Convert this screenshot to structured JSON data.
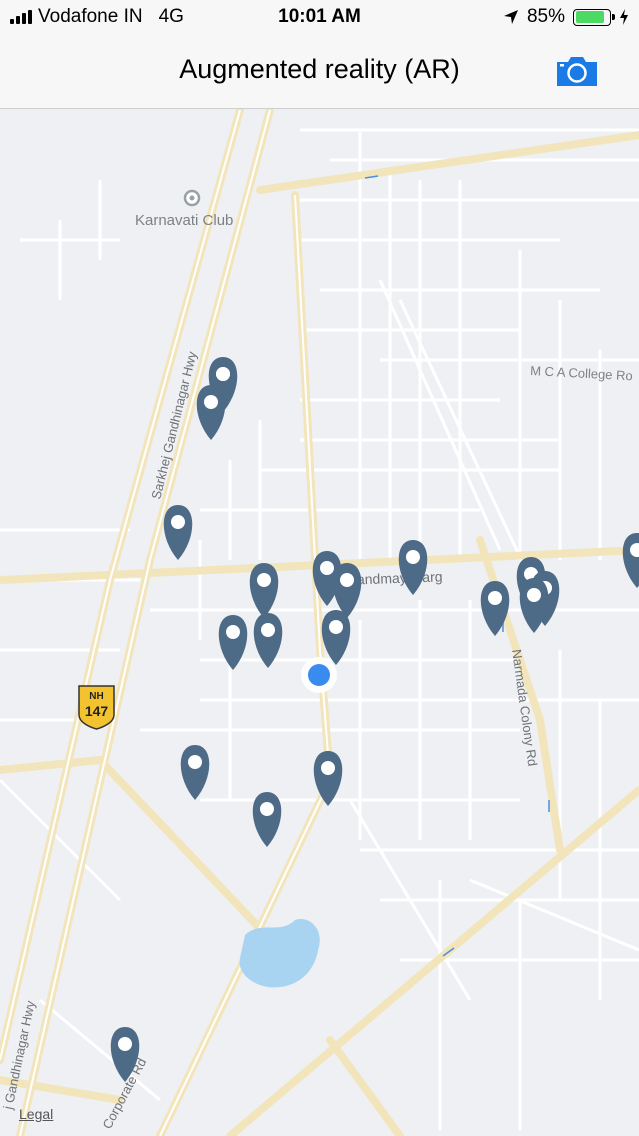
{
  "status_bar": {
    "carrier": "Vodafone IN",
    "network": "4G",
    "time": "10:01 AM",
    "battery_percent": "85%",
    "battery_level": 0.85
  },
  "nav": {
    "title": "Augmented reality (AR)",
    "camera_icon": "camera-icon"
  },
  "map": {
    "labels": {
      "karnavati_club": "Karnavati Club",
      "mca_college": "M C A College Ro",
      "sarkhej_top": "Sarkhej Gandhinagar Hwy",
      "sarkhej_bottom": "j Gandhinagar Hwy",
      "anandmay_marg": "Anandmay Marg",
      "narmada_colony": "Narmada Colony Rd",
      "corporate_rd": "Corporate Rd",
      "nh_label": "NH",
      "nh_number": "147"
    },
    "legal": "Legal",
    "colors": {
      "background": "#eef0f3",
      "major_road": "#f5e6b8",
      "minor_road": "#ffffff",
      "pin": "#4d6a86",
      "user_location": "#3a8bf0",
      "water": "#a8d4f2"
    }
  }
}
